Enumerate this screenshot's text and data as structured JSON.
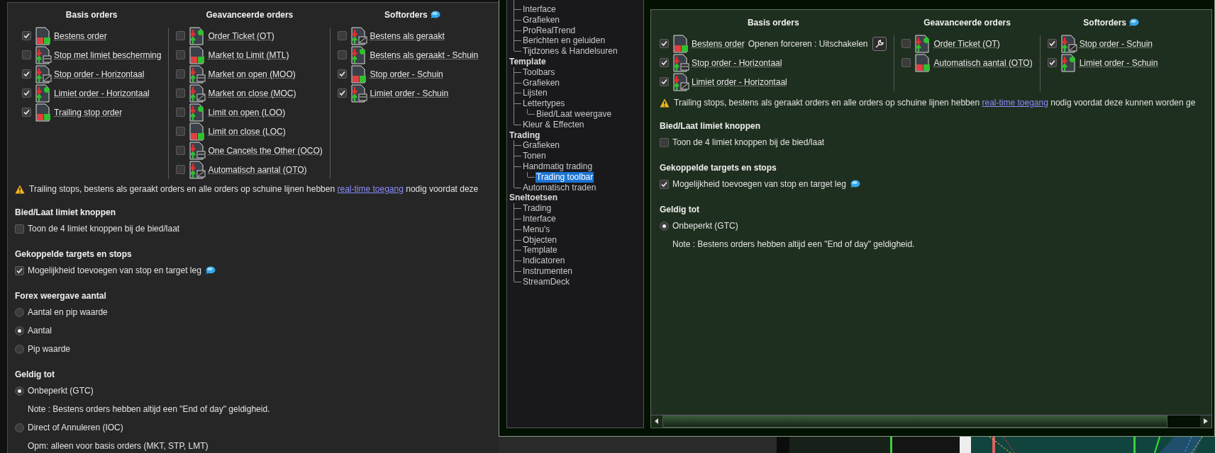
{
  "left_panel": {
    "order_groups": [
      {
        "title": "Basis orders",
        "items": [
          {
            "label": "Bestens order",
            "checked": true
          },
          {
            "label": "Stop met limiet bescherming",
            "checked": false
          },
          {
            "label": "Stop order - Horizontaal",
            "checked": true
          },
          {
            "label": "Limiet order - Horizontaal",
            "checked": true
          },
          {
            "label": "Trailing stop order",
            "checked": true
          }
        ]
      },
      {
        "title": "Geavanceerde orders",
        "items": [
          {
            "label": "Order Ticket (OT)",
            "checked": false
          },
          {
            "label": "Market to Limit (MTL)",
            "checked": false
          },
          {
            "label": "Market on open (MOO)",
            "checked": false
          },
          {
            "label": "Market on close (MOC)",
            "checked": false
          },
          {
            "label": "Limit on open (LOO)",
            "checked": false
          },
          {
            "label": "Limit on close (LOC)",
            "checked": false
          },
          {
            "label": "One Cancels the Other (OCO)",
            "checked": false
          },
          {
            "label": "Automatisch aantal (OTO)",
            "checked": false
          }
        ]
      },
      {
        "title": "Softorders",
        "info_icon": true,
        "items": [
          {
            "label": "Bestens als geraakt",
            "checked": false
          },
          {
            "label": "Bestens als geraakt - Schuin",
            "checked": false
          },
          {
            "label": "Stop order - Schuin",
            "checked": true
          },
          {
            "label": "Limiet order - Schuin",
            "checked": true
          }
        ]
      }
    ],
    "warning": {
      "text_before": "Trailing stops, bestens als geraakt orders en alle orders op schuine lijnen hebben",
      "link": "real-time toegang",
      "text_after": "nodig voordat deze"
    },
    "sections": [
      {
        "title": "Bied/Laat limiet knoppen",
        "options": [
          {
            "kind": "checkbox",
            "label": "Toon de 4 limiet knoppen bij de bied/laat",
            "checked": false
          }
        ]
      },
      {
        "title": "Gekoppelde targets en stops",
        "options": [
          {
            "kind": "checkbox",
            "label": "Mogelijkheid toevoegen van stop en target leg",
            "checked": true,
            "info_icon": true
          }
        ]
      },
      {
        "title": "Forex weergave aantal",
        "options": [
          {
            "kind": "radio",
            "label": "Aantal en pip waarde",
            "selected": false
          },
          {
            "kind": "radio",
            "label": "Aantal",
            "selected": true
          },
          {
            "kind": "radio",
            "label": "Pip waarde",
            "selected": false
          }
        ]
      },
      {
        "title": "Geldig tot",
        "options": [
          {
            "kind": "radio",
            "label": "Onbeperkt (GTC)",
            "selected": true
          },
          {
            "kind": "note",
            "label": "Note : Bestens orders hebben altijd een \"End of day\" geldigheid."
          },
          {
            "kind": "radio",
            "label": "Direct of Annuleren (IOC)",
            "selected": false
          },
          {
            "kind": "note",
            "label": "Opm: alleen voor basis orders (MKT, STP, LMT)"
          }
        ]
      }
    ]
  },
  "settings_window": {
    "tree": [
      {
        "children": [
          {
            "label": "Interface",
            "selected": false
          },
          {
            "label": "Grafieken",
            "selected": false
          },
          {
            "label": "ProRealTrend",
            "selected": false
          },
          {
            "label": "Berichten en geluiden",
            "selected": false
          },
          {
            "label": "Tijdzones & Handelsuren",
            "selected": false
          }
        ]
      },
      {
        "label": "Template",
        "selected": false,
        "children": [
          {
            "label": "Toolbars",
            "selected": false
          },
          {
            "label": "Grafieken",
            "selected": false
          },
          {
            "label": "Lijsten",
            "selected": false
          },
          {
            "label": "Lettertypes",
            "selected": false,
            "children": [
              {
                "label": "Bied/Laat weergave",
                "selected": false
              }
            ]
          },
          {
            "label": "Kleur & Effecten",
            "selected": false
          }
        ]
      },
      {
        "label": "Trading",
        "selected": false,
        "children": [
          {
            "label": "Grafieken",
            "selected": false
          },
          {
            "label": "Tonen",
            "selected": false
          },
          {
            "label": "Handmatig trading",
            "selected": false,
            "children": [
              {
                "label": "Trading toolbar",
                "selected": true
              }
            ]
          },
          {
            "label": "Automatisch traden",
            "selected": false
          }
        ]
      },
      {
        "label": "Sneltoetsen",
        "selected": false,
        "children": [
          {
            "label": "Trading",
            "selected": false
          },
          {
            "label": "Interface",
            "selected": false
          },
          {
            "label": "Menu's",
            "selected": false
          },
          {
            "label": "Objecten",
            "selected": false
          },
          {
            "label": "Template",
            "selected": false
          },
          {
            "label": "Indicatoren",
            "selected": false
          },
          {
            "label": "Instrumenten",
            "selected": false
          },
          {
            "label": "StreamDeck",
            "selected": false
          }
        ]
      }
    ],
    "panel": {
      "order_groups": [
        {
          "title": "Basis orders",
          "items": [
            {
              "label": "Bestens order",
              "checked": true,
              "extra": "Openen forceren : Uitschakelen"
            },
            {
              "label": "Stop order - Horizontaal",
              "checked": true
            },
            {
              "label": "Limiet order - Horizontaal",
              "checked": true
            }
          ]
        },
        {
          "title": "Geavanceerde orders",
          "items": [
            {
              "label": "Order Ticket (OT)",
              "checked": false
            },
            {
              "label": "Automatisch aantal (OTO)",
              "checked": false
            }
          ]
        },
        {
          "title": "Softorders",
          "info_icon": true,
          "items": [
            {
              "label": "Stop order - Schuin",
              "checked": true
            },
            {
              "label": "Limiet order - Schuin",
              "checked": true
            }
          ]
        }
      ],
      "warning": {
        "text_before": "Trailing stops, bestens als geraakt orders en alle orders op schuine lijnen hebben",
        "link": "real-time toegang",
        "text_after": "nodig voordat deze kunnen worden ge"
      },
      "sections": [
        {
          "title": "Bied/Laat limiet knoppen",
          "options": [
            {
              "kind": "checkbox",
              "label": "Toon de 4 limiet knoppen bij de bied/laat",
              "checked": false
            }
          ]
        },
        {
          "title": "Gekoppelde targets en stops",
          "options": [
            {
              "kind": "checkbox",
              "label": "Mogelijkheid toevoegen van stop en target leg",
              "checked": true,
              "info_icon": true
            }
          ]
        },
        {
          "title": "Geldig tot",
          "options": [
            {
              "kind": "radio",
              "label": "Onbeperkt (GTC)",
              "selected": true
            },
            {
              "kind": "note",
              "label": "Note : Bestens orders hebben altijd een \"End of day\" geldigheid."
            }
          ]
        }
      ]
    }
  }
}
